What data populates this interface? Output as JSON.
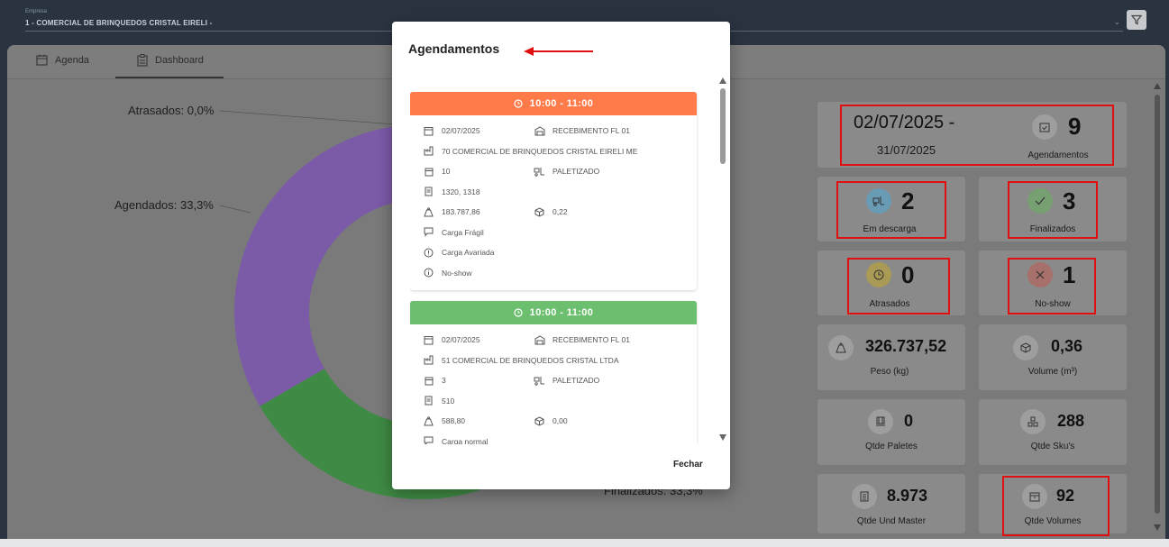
{
  "company": {
    "label": "Empresa",
    "value": "1 - COMERCIAL DE BRINQUEDOS CRISTAL EIRELI -"
  },
  "tabs": [
    {
      "label": "Agenda",
      "icon": "calendar-icon"
    },
    {
      "label": "Dashboard",
      "icon": "clipboard-icon"
    }
  ],
  "chart_data": {
    "type": "pie",
    "labels": [
      "Atrasados: 0,0%",
      "Agendados: 33,3%",
      "Finalizados: 33,3%"
    ],
    "categories": [
      "Atrasados",
      "Agendados",
      "Finalizados"
    ],
    "values": [
      0.0,
      33.3,
      33.3
    ],
    "colors": [
      "#7b5aa8",
      "#7b5aa8",
      "#3f8a44"
    ],
    "style": "donut"
  },
  "stats": {
    "date_range_start": "02/07/2025 -",
    "date_range_end": "31/07/2025",
    "agendamentos": {
      "value": "9",
      "label": "Agendamentos"
    },
    "em_descarga": {
      "value": "2",
      "label": "Em descarga"
    },
    "finalizados": {
      "value": "3",
      "label": "Finalizados"
    },
    "atrasados": {
      "value": "0",
      "label": "Atrasados"
    },
    "noshow": {
      "value": "1",
      "label": "No-show"
    },
    "peso": {
      "value": "326.737,52",
      "label": "Peso (kg)"
    },
    "volume": {
      "value": "0,36",
      "label": "Volume (m³)"
    },
    "paletes": {
      "value": "0",
      "label": "Qtde Paletes"
    },
    "skus": {
      "value": "288",
      "label": "Qtde Sku's"
    },
    "und_master": {
      "value": "8.973",
      "label": "Qtde Und Master"
    },
    "volumes": {
      "value": "92",
      "label": "Qtde Volumes"
    }
  },
  "modal": {
    "title": "Agendamentos",
    "close_label": "Fechar",
    "appointments": [
      {
        "time": "10:00 - 11:00",
        "color": "#ff7b4a",
        "date": "02/07/2025",
        "dock": "RECEBIMENTO FL 01",
        "supplier": "70 COMERCIAL DE BRINQUEDOS CRISTAL EIRELI ME",
        "qty": "10",
        "load_type": "PALETIZADO",
        "docs": "1320, 1318",
        "weight": "183.787,86",
        "volume": "0,22",
        "notes": [
          "Carga Frágil",
          "Carga Avariada",
          "No-show"
        ]
      },
      {
        "time": "10:00 - 11:00",
        "color": "#6cbf6e",
        "date": "02/07/2025",
        "dock": "RECEBIMENTO FL 01",
        "supplier": "51 COMERCIAL DE BRINQUEDOS CRISTAL LTDA",
        "qty": "3",
        "load_type": "PALETIZADO",
        "docs": "510",
        "weight": "588,80",
        "volume": "0,00",
        "notes": [
          "Carga normal"
        ]
      }
    ]
  }
}
